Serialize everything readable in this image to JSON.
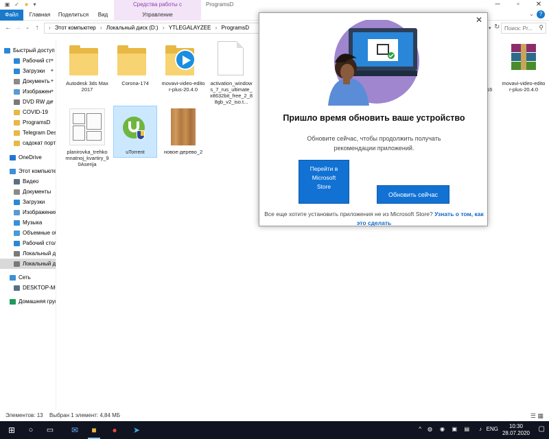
{
  "window": {
    "title": "ProgramsD",
    "context_group": "Средства работы с приложениями",
    "controls": [
      "─",
      "▫",
      "✕"
    ]
  },
  "ribbon": {
    "tabs": [
      "Файл",
      "Главная",
      "Поделиться",
      "Вид",
      "Управление"
    ]
  },
  "address": {
    "crumbs": [
      "Этот компьютер",
      "Локальный диск (D:)",
      "YTLEGALAYZEE",
      "ProgramsD"
    ],
    "search_placeholder": "Поиск: Pr..."
  },
  "sidebar": {
    "items": [
      {
        "label": "Быстрый доступ",
        "pinned": false,
        "color": "#2b88d8"
      },
      {
        "label": "Рабочий ст",
        "pinned": true,
        "color": "#2b88d8"
      },
      {
        "label": "Загрузки",
        "pinned": true,
        "color": "#2b88d8"
      },
      {
        "label": "Документь",
        "pinned": true,
        "color": "#8a8a8a"
      },
      {
        "label": "Изображен",
        "pinned": true,
        "color": "#5a9bd5"
      },
      {
        "label": "DVD RW ди",
        "pinned": true,
        "color": "#7a7a7a"
      },
      {
        "label": "COVID-19",
        "pinned": false,
        "color": "#e8b845"
      },
      {
        "label": "ProgramsD",
        "pinned": false,
        "color": "#e8b845"
      },
      {
        "label": "Telegram Desk",
        "pinned": false,
        "color": "#e8b845"
      },
      {
        "label": "садокат порта",
        "pinned": false,
        "color": "#e8b845"
      },
      {
        "label": "OneDrive",
        "pinned": false,
        "color": "#1e78d2"
      },
      {
        "label": "Этот компьютер",
        "pinned": false,
        "color": "#3c8fd8"
      },
      {
        "label": "Видео",
        "pinned": false,
        "color": "#5a6f86"
      },
      {
        "label": "Документы",
        "pinned": false,
        "color": "#8a8a8a"
      },
      {
        "label": "Загрузки",
        "pinned": false,
        "color": "#2b88d8"
      },
      {
        "label": "Изображения",
        "pinned": false,
        "color": "#5a9bd5"
      },
      {
        "label": "Музыка",
        "pinned": false,
        "color": "#3c8fd8"
      },
      {
        "label": "Объемные об",
        "pinned": false,
        "color": "#4a9ad8"
      },
      {
        "label": "Рабочий стол",
        "pinned": false,
        "color": "#2b88d8"
      },
      {
        "label": "Локальный ди",
        "pinned": false,
        "color": "#7a7a7a"
      },
      {
        "label": "Локальный ди",
        "pinned": false,
        "color": "#7a7a7a",
        "selected": true
      },
      {
        "label": "Сеть",
        "pinned": false,
        "color": "#3c8fd8"
      },
      {
        "label": "DESKTOP-MQ",
        "pinned": false,
        "color": "#5a6f86"
      },
      {
        "label": "Домашняя груп",
        "pinned": false,
        "color": "#1c9a5a"
      }
    ]
  },
  "files": [
    {
      "name": "Autodesk 3ds Max 2017",
      "kind": "folder"
    },
    {
      "name": "Corona-174",
      "kind": "folder"
    },
    {
      "name": "movavi-video-editor-plus-20.4.0",
      "kind": "folder-app"
    },
    {
      "name": "activation_windows_7_rus_ultimate_x8632bit_free_2_88gb_v2_iso.t...",
      "kind": "doc"
    },
    {
      "name": "movavi-video-editor-plus-20.4.0",
      "kind": "rar"
    },
    {
      "name": "planirovka_trehkomnatnoj_kvartiry_90Aserija",
      "kind": "plan"
    },
    {
      "name": "uTorrent",
      "kind": "utorrent",
      "selected": true
    },
    {
      "name": "новое-дерево_2",
      "kind": "wood"
    }
  ],
  "status": {
    "count": "Элементов: 13",
    "selected": "Выбран 1 элемент: 4,84 МБ"
  },
  "dialog": {
    "title": "Пришло время обновить ваше устройство",
    "body": "Обновите сейчас, чтобы продолжить получать рекомендации приложений.",
    "store_button": "Перейти в Microsoft Store",
    "update_button": "Обновить сейчас",
    "footer_text": "Все еще хотите установить приложения не из Microsoft Store?",
    "footer_link": "Узнать о том, как это сделать"
  },
  "taskbar": {
    "lang": "ENG",
    "time": "10:30",
    "date": "28.07.2020"
  },
  "colors": {
    "accent": "#1172d4",
    "file_tab": "#1979ca",
    "manage_tab": "#f3e4f8",
    "selection": "#cce8ff",
    "taskbar": "#0f1420"
  }
}
